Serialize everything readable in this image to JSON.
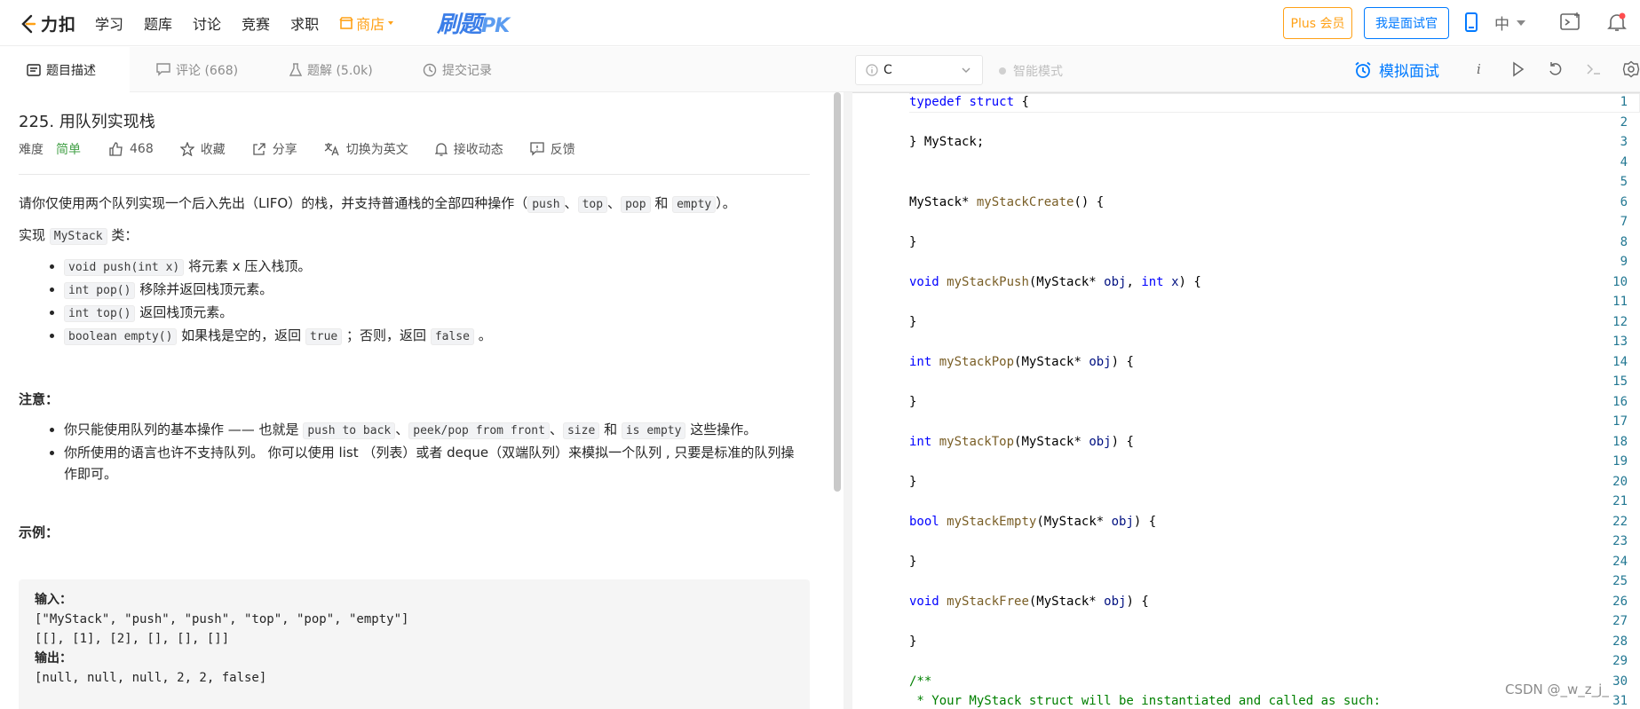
{
  "nav": {
    "logo_text": "力扣",
    "links": [
      "学习",
      "题库",
      "讨论",
      "竞赛",
      "求职"
    ],
    "shop_label": "商店",
    "pk_label": "刷题",
    "pk_suffix": "PK",
    "plus_label": "Plus 会员",
    "interviewer_label": "我是面试官",
    "lang_label": "中"
  },
  "left_tabs": [
    {
      "label": "题目描述",
      "icon": "description-icon"
    },
    {
      "label": "评论 (668)",
      "icon": "comment-icon"
    },
    {
      "label": "题解 (5.0k)",
      "icon": "flask-icon"
    },
    {
      "label": "提交记录",
      "icon": "clock-icon"
    }
  ],
  "problem": {
    "title": "225. 用队列实现栈",
    "difficulty_label": "难度",
    "difficulty": "简单",
    "likes": "468",
    "collect": "收藏",
    "share": "分享",
    "switch_en": "切换为英文",
    "subscribe": "接收动态",
    "feedback": "反馈",
    "intro_a": "请你仅使用两个队列实现一个后入先出（LIFO）的栈，并支持普通栈的全部四种操作（",
    "intro_push": "push",
    "intro_sep1": "、",
    "intro_top": "top",
    "intro_sep2": "、",
    "intro_pop": "pop",
    "intro_and": " 和 ",
    "intro_empty": "empty",
    "intro_end": "）。",
    "impl_a": "实现 ",
    "impl_code": "MyStack",
    "impl_b": " 类：",
    "methods": [
      {
        "code": "void push(int x)",
        "text": " 将元素 x 压入栈顶。"
      },
      {
        "code": "int pop()",
        "text": " 移除并返回栈顶元素。"
      },
      {
        "code": "int top()",
        "text": " 返回栈顶元素。"
      },
      {
        "code": "boolean empty()",
        "text": " 如果栈是空的，返回 "
      }
    ],
    "empty_true": "true",
    "empty_mid": " ；否则，返回 ",
    "empty_false": "false",
    "empty_end": " 。",
    "note_title": "注意：",
    "note1_a": "你只能使用队列的基本操作 —— 也就是 ",
    "note1_c1": "push to back",
    "note1_s1": "、",
    "note1_c2": "peek/pop from front",
    "note1_s2": "、",
    "note1_c3": "size",
    "note1_and": " 和 ",
    "note1_c4": "is empty",
    "note1_end": " 这些操作。",
    "note2": "你所使用的语言也许不支持队列。 你可以使用 list （列表）或者 deque（双端队列）来模拟一个队列 , 只要是标准的队列操作即可。",
    "example_title": "示例：",
    "example_input_label": "输入：",
    "example_input_1": "[\"MyStack\", \"push\", \"push\", \"top\", \"pop\", \"empty\"]",
    "example_input_2": "[[], [1], [2], [], [], []]",
    "example_output_label": "输出：",
    "example_output": "[null, null, null, 2, 2, false]"
  },
  "editor_toolbar": {
    "language": "C",
    "smart_mode": "智能模式",
    "mock_interview": "模拟面试"
  },
  "code_lines": [
    {
      "n": "1",
      "segs": [
        [
          "k",
          "typedef"
        ],
        [
          "p",
          " "
        ],
        [
          "k",
          "struct"
        ],
        [
          "p",
          " {"
        ]
      ]
    },
    {
      "n": "2",
      "segs": []
    },
    {
      "n": "3",
      "segs": [
        [
          "p",
          "} MyStack;"
        ]
      ]
    },
    {
      "n": "4",
      "segs": []
    },
    {
      "n": "5",
      "segs": []
    },
    {
      "n": "6",
      "segs": [
        [
          "p",
          "MyStack* "
        ],
        [
          "f",
          "myStackCreate"
        ],
        [
          "p",
          "() {"
        ]
      ]
    },
    {
      "n": "7",
      "segs": []
    },
    {
      "n": "8",
      "segs": [
        [
          "p",
          "}"
        ]
      ]
    },
    {
      "n": "9",
      "segs": []
    },
    {
      "n": "10",
      "segs": [
        [
          "k",
          "void"
        ],
        [
          "p",
          " "
        ],
        [
          "f",
          "myStackPush"
        ],
        [
          "p",
          "(MyStack* "
        ],
        [
          "v",
          "obj"
        ],
        [
          "p",
          ", "
        ],
        [
          "k",
          "int"
        ],
        [
          "p",
          " "
        ],
        [
          "v",
          "x"
        ],
        [
          "p",
          ") {"
        ]
      ]
    },
    {
      "n": "11",
      "segs": []
    },
    {
      "n": "12",
      "segs": [
        [
          "p",
          "}"
        ]
      ]
    },
    {
      "n": "13",
      "segs": []
    },
    {
      "n": "14",
      "segs": [
        [
          "k",
          "int"
        ],
        [
          "p",
          " "
        ],
        [
          "f",
          "myStackPop"
        ],
        [
          "p",
          "(MyStack* "
        ],
        [
          "v",
          "obj"
        ],
        [
          "p",
          ") {"
        ]
      ]
    },
    {
      "n": "15",
      "segs": []
    },
    {
      "n": "16",
      "segs": [
        [
          "p",
          "}"
        ]
      ]
    },
    {
      "n": "17",
      "segs": []
    },
    {
      "n": "18",
      "segs": [
        [
          "k",
          "int"
        ],
        [
          "p",
          " "
        ],
        [
          "f",
          "myStackTop"
        ],
        [
          "p",
          "(MyStack* "
        ],
        [
          "v",
          "obj"
        ],
        [
          "p",
          ") {"
        ]
      ]
    },
    {
      "n": "19",
      "segs": []
    },
    {
      "n": "20",
      "segs": [
        [
          "p",
          "}"
        ]
      ]
    },
    {
      "n": "21",
      "segs": []
    },
    {
      "n": "22",
      "segs": [
        [
          "k",
          "bool"
        ],
        [
          "p",
          " "
        ],
        [
          "f",
          "myStackEmpty"
        ],
        [
          "p",
          "(MyStack* "
        ],
        [
          "v",
          "obj"
        ],
        [
          "p",
          ") {"
        ]
      ]
    },
    {
      "n": "23",
      "segs": []
    },
    {
      "n": "24",
      "segs": [
        [
          "p",
          "}"
        ]
      ]
    },
    {
      "n": "25",
      "segs": []
    },
    {
      "n": "26",
      "segs": [
        [
          "k",
          "void"
        ],
        [
          "p",
          " "
        ],
        [
          "f",
          "myStackFree"
        ],
        [
          "p",
          "(MyStack* "
        ],
        [
          "v",
          "obj"
        ],
        [
          "p",
          ") {"
        ]
      ]
    },
    {
      "n": "27",
      "segs": []
    },
    {
      "n": "28",
      "segs": [
        [
          "p",
          "}"
        ]
      ]
    },
    {
      "n": "29",
      "segs": []
    },
    {
      "n": "30",
      "segs": [
        [
          "c",
          "/**"
        ]
      ]
    },
    {
      "n": "31",
      "segs": [
        [
          "c",
          " * Your MyStack struct will be instantiated and called as such:"
        ]
      ]
    }
  ],
  "watermark": "CSDN @_w_z_j_",
  "colors": {
    "accent": "#007aff",
    "orange": "#ffa116",
    "easy": "#43a047"
  }
}
